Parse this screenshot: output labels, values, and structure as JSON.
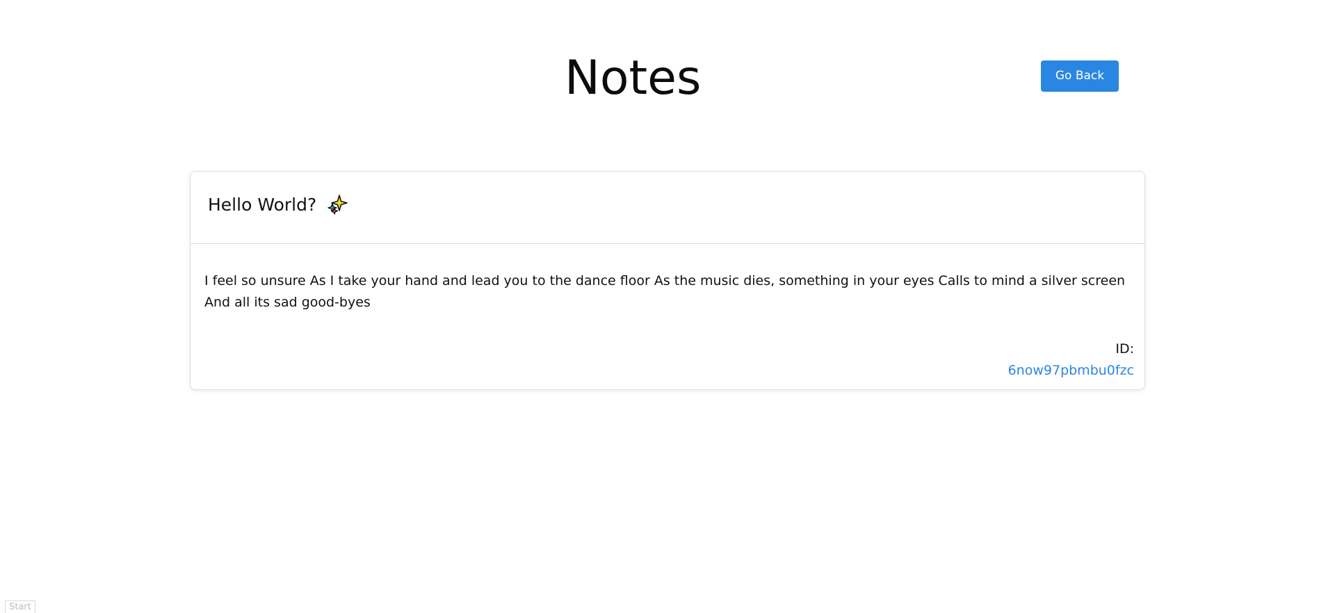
{
  "page": {
    "title": "Notes"
  },
  "header": {
    "go_back_label": "Go Back"
  },
  "note": {
    "title": "Hello World?",
    "title_icon": "sparkles-icon",
    "body": "I feel so unsure As I take your hand and lead you to the dance floor As the music dies, something in your eyes Calls to mind a silver screen And all its sad good-byes",
    "id_label": "ID:",
    "id_value": "6now97pbmbu0fzc"
  },
  "footer": {
    "start_label": "Start"
  },
  "colors": {
    "accent": "#2a87e1",
    "text": "#111111",
    "card_border": "#dedede"
  }
}
